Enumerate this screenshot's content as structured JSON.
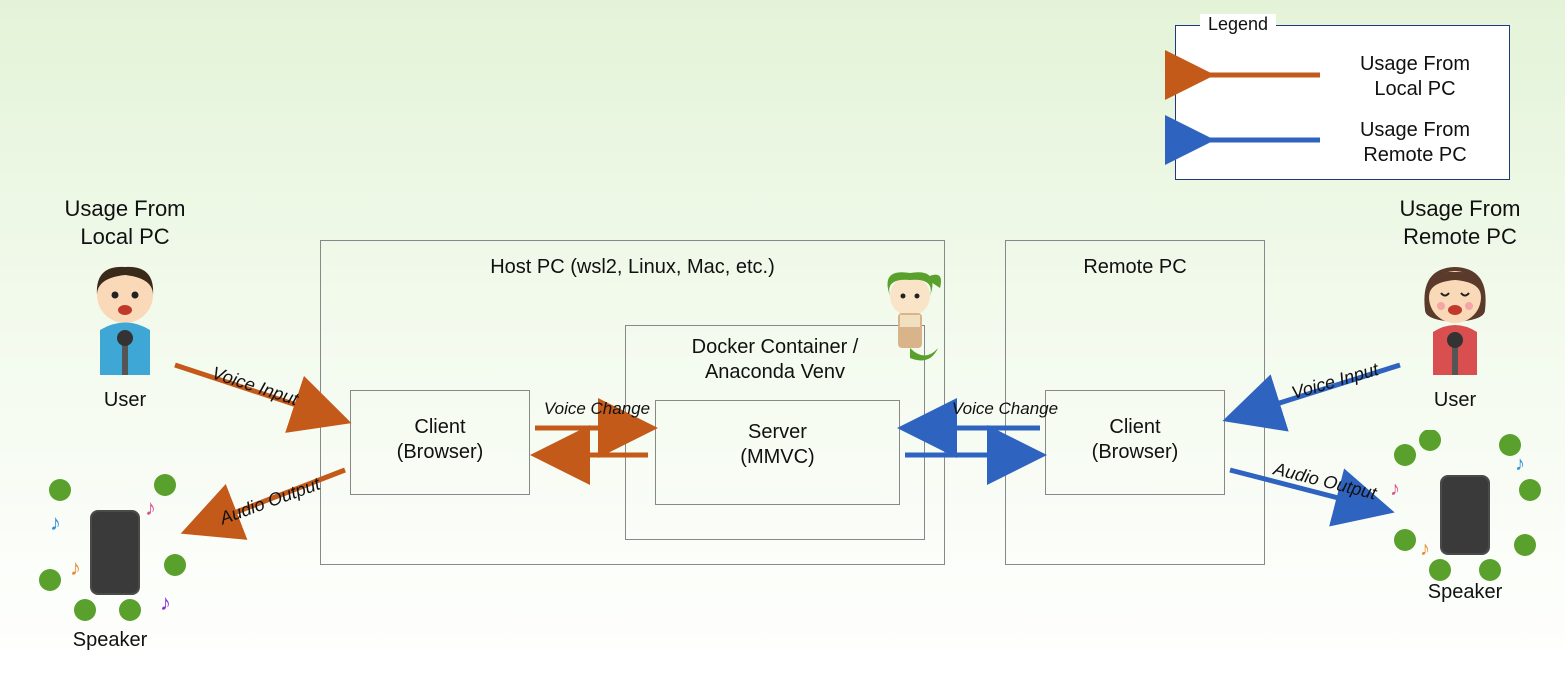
{
  "legend": {
    "title": "Legend",
    "local_label": "Usage From\nLocal PC",
    "remote_label": "Usage From\nRemote PC"
  },
  "colors": {
    "local_arrow": "#c45a1a",
    "remote_arrow": "#2f63c0",
    "box_border": "#888888",
    "legend_border": "#1f3a7a"
  },
  "left": {
    "heading": "Usage From\nLocal PC",
    "user_label": "User",
    "speaker_label": "Speaker",
    "voice_input": "Voice Input",
    "audio_output": "Audio Output"
  },
  "right": {
    "heading": "Usage From\nRemote PC",
    "user_label": "User",
    "speaker_label": "Speaker",
    "voice_input": "Voice Input",
    "audio_output": "Audio Output"
  },
  "host": {
    "title": "Host PC (wsl2, Linux, Mac, etc.)",
    "client": "Client\n(Browser)",
    "docker_title": "Docker Container /\nAnaconda Venv",
    "server": "Server\n(MMVC)",
    "voice_change": "Voice Change"
  },
  "remote_pc": {
    "title": "Remote PC",
    "client": "Client\n(Browser)",
    "voice_change": "Voice Change"
  }
}
